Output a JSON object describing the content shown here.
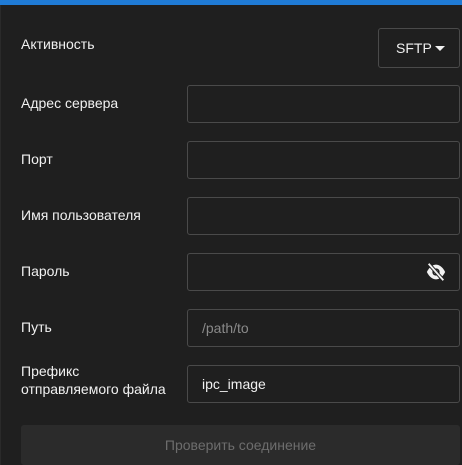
{
  "activity": {
    "label": "Активность",
    "value": "SFTP"
  },
  "fields": {
    "server": {
      "label": "Адрес сервера",
      "value": ""
    },
    "port": {
      "label": "Порт",
      "value": ""
    },
    "username": {
      "label": "Имя пользователя",
      "value": ""
    },
    "password": {
      "label": "Пароль",
      "value": ""
    },
    "path": {
      "label": "Путь",
      "placeholder": "/path/to"
    },
    "prefix": {
      "label_line1": "Префикс",
      "label_line2": "отправляемого файла",
      "value": "ipc_image"
    }
  },
  "actions": {
    "check_label": "Проверить соединение"
  },
  "colors": {
    "accent": "#1f7bd6",
    "panel": "#1f1f1f",
    "border": "#4a4a4a",
    "text": "#f1f1f1",
    "muted": "#8a8a8a"
  }
}
